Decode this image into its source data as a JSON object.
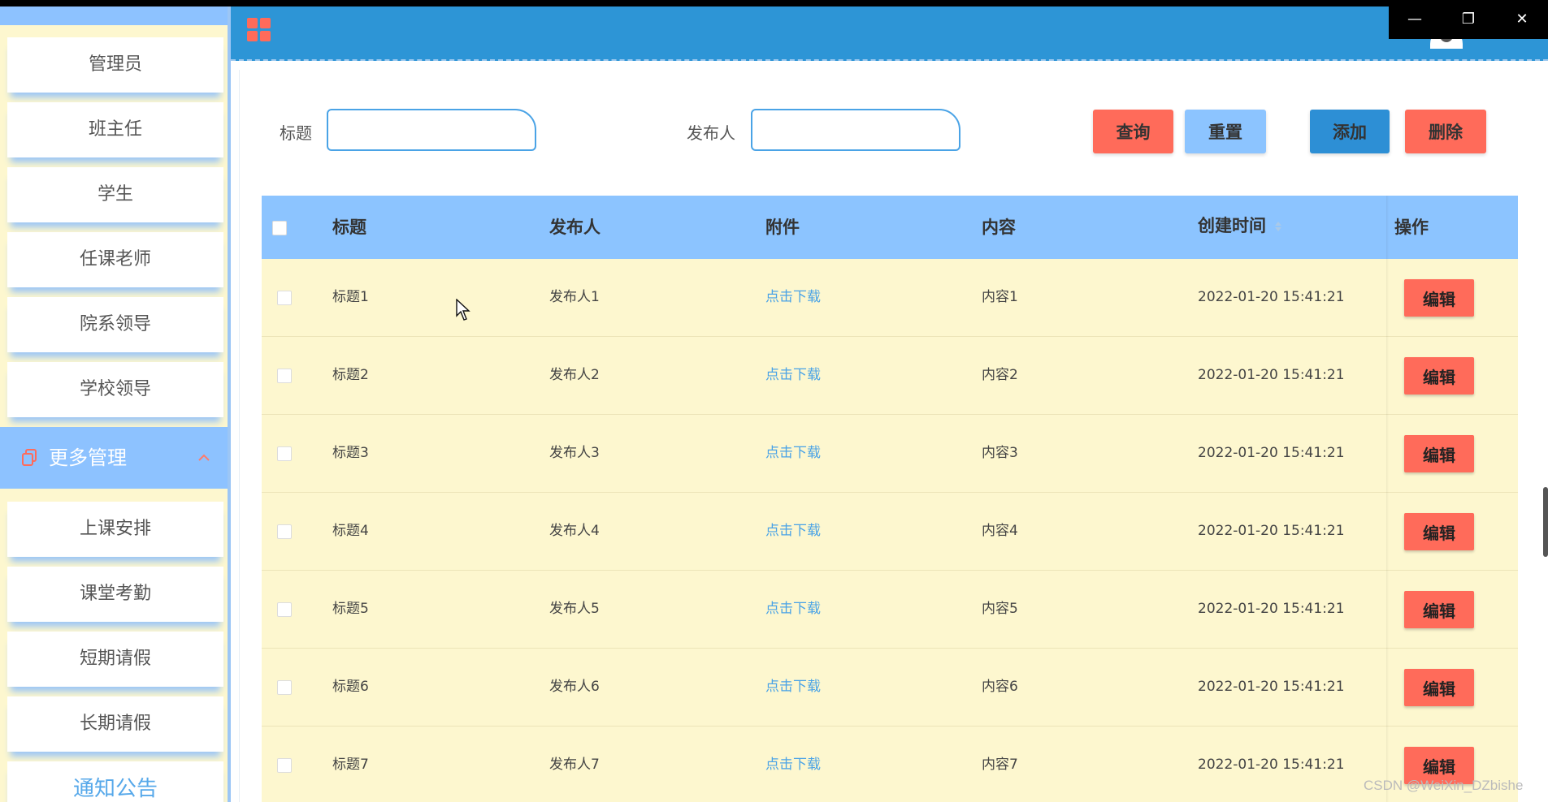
{
  "sidebar": {
    "items": [
      "管理员",
      "班主任",
      "学生",
      "任课老师",
      "院系领导",
      "学校领导"
    ],
    "group": {
      "label": "更多管理",
      "icon": "copy-icon",
      "chevron": "chevron-up-icon"
    },
    "sub_items": [
      "上课安排",
      "课堂考勤",
      "短期请假",
      "长期请假"
    ],
    "notice": "通知公告"
  },
  "header": {
    "menu_icon": "grid-icon",
    "avatar_icon": "user-avatar"
  },
  "window_controls": {
    "minimize": "—",
    "restore": "❐",
    "close": "✕"
  },
  "search": {
    "title_label": "标题",
    "title_value": "",
    "publisher_label": "发布人",
    "publisher_value": ""
  },
  "buttons": {
    "query": "查询",
    "reset": "重置",
    "add": "添加",
    "delete": "删除"
  },
  "colors": {
    "header_blue": "#2d95d6",
    "table_header": "#8cc4ff",
    "row_bg": "#fdf7cf",
    "danger": "#ff6b5a",
    "reset_blue": "#8cc4ff",
    "add_blue": "#2d8fd5",
    "link_blue": "#4aa3e6"
  },
  "table": {
    "headers": {
      "title": "标题",
      "publisher": "发布人",
      "attachment": "附件",
      "content": "内容",
      "created": "创建时间",
      "actions": "操作"
    },
    "rows": [
      {
        "title": "标题1",
        "publisher": "发布人1",
        "attachment": "点击下载",
        "content": "内容1",
        "created": "2022-01-20 15:41:21",
        "action": "编辑"
      },
      {
        "title": "标题2",
        "publisher": "发布人2",
        "attachment": "点击下载",
        "content": "内容2",
        "created": "2022-01-20 15:41:21",
        "action": "编辑"
      },
      {
        "title": "标题3",
        "publisher": "发布人3",
        "attachment": "点击下载",
        "content": "内容3",
        "created": "2022-01-20 15:41:21",
        "action": "编辑"
      },
      {
        "title": "标题4",
        "publisher": "发布人4",
        "attachment": "点击下载",
        "content": "内容4",
        "created": "2022-01-20 15:41:21",
        "action": "编辑"
      },
      {
        "title": "标题5",
        "publisher": "发布人5",
        "attachment": "点击下载",
        "content": "内容5",
        "created": "2022-01-20 15:41:21",
        "action": "编辑"
      },
      {
        "title": "标题6",
        "publisher": "发布人6",
        "attachment": "点击下载",
        "content": "内容6",
        "created": "2022-01-20 15:41:21",
        "action": "编辑"
      },
      {
        "title": "标题7",
        "publisher": "发布人7",
        "attachment": "点击下载",
        "content": "内容7",
        "created": "2022-01-20 15:41:21",
        "action": "编辑"
      }
    ]
  },
  "watermark": "CSDN @WeiXin_DZbishe"
}
